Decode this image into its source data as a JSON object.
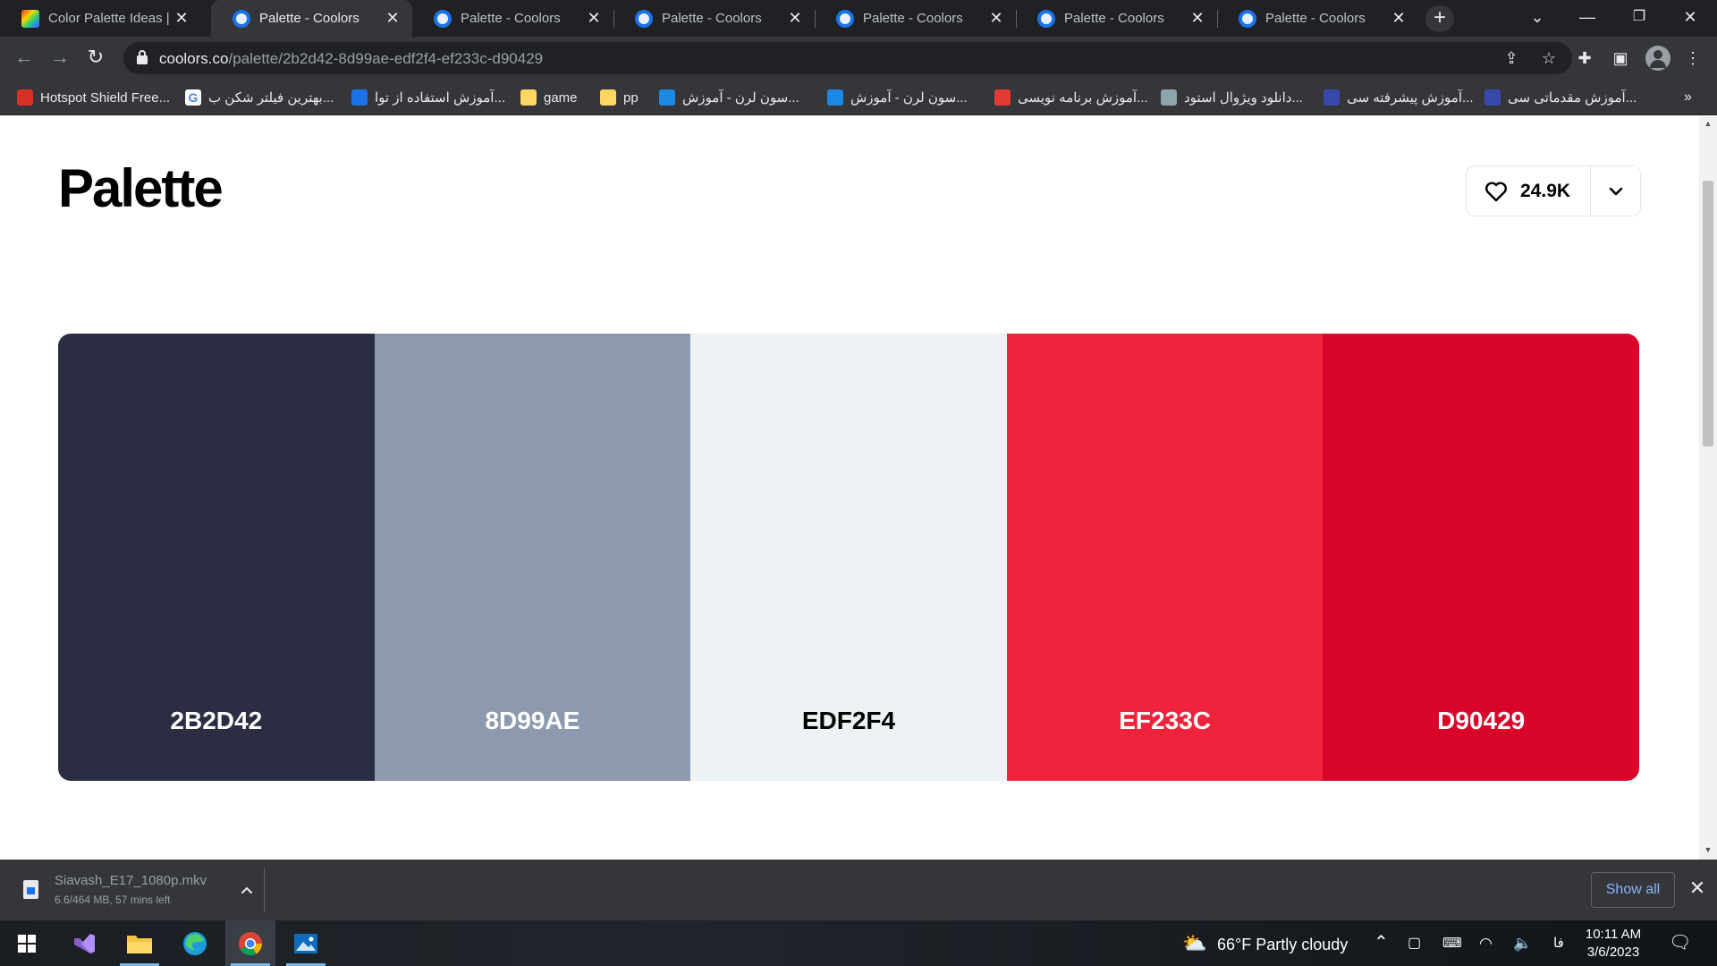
{
  "browser": {
    "tabs": [
      {
        "title": "Color Palette Ideas | C",
        "favicon": "colorpalettes-favicon",
        "active": false
      },
      {
        "title": "Palette - Coolors",
        "favicon": "coolors-favicon",
        "active": true
      },
      {
        "title": "Palette - Coolors",
        "favicon": "coolors-favicon",
        "active": false
      },
      {
        "title": "Palette - Coolors",
        "favicon": "coolors-favicon",
        "active": false
      },
      {
        "title": "Palette - Coolors",
        "favicon": "coolors-favicon",
        "active": false
      },
      {
        "title": "Palette - Coolors",
        "favicon": "coolors-favicon",
        "active": false
      },
      {
        "title": "Palette - Coolors",
        "favicon": "coolors-favicon",
        "active": false
      }
    ],
    "url_host": "coolors.co",
    "url_path": "/palette/2b2d42-8d99ae-edf2f4-ef233c-d90429",
    "bookmarks": [
      {
        "label": "Hotspot Shield Free...",
        "icon": "hotspot-icon"
      },
      {
        "label": "بهترین فیلتر شکن ب...",
        "icon": "google-icon"
      },
      {
        "label": "آموزش استفاده از توا...",
        "icon": "site-icon"
      },
      {
        "label": "game",
        "icon": "folder-icon"
      },
      {
        "label": "pp",
        "icon": "folder-icon"
      },
      {
        "label": "سون لرن - آموزش...",
        "icon": "sevenlearn-icon"
      },
      {
        "label": "سون لرن - آموزش...",
        "icon": "sevenlearn-icon"
      },
      {
        "label": "آموزش برنامه نویسی...",
        "icon": "site-icon"
      },
      {
        "label": "دانلود ویژوال استود...",
        "icon": "site-icon"
      },
      {
        "label": "آموزش پیشرفته سی...",
        "icon": "site-icon"
      },
      {
        "label": "آموزش مقدماتی سی...",
        "icon": "site-icon"
      }
    ]
  },
  "page": {
    "title": "Palette",
    "likes": "24.9K",
    "swatches": [
      {
        "hex": "2B2D42",
        "color": "#2B2D42",
        "text_color": "#ffffff"
      },
      {
        "hex": "8D99AE",
        "color": "#8D99AE",
        "text_color": "#ffffff"
      },
      {
        "hex": "EDF2F4",
        "color": "#EDF2F4",
        "text_color": "#000000"
      },
      {
        "hex": "EF233C",
        "color": "#EF233C",
        "text_color": "#ffffff"
      },
      {
        "hex": "D90429",
        "color": "#D90429",
        "text_color": "#ffffff"
      }
    ]
  },
  "download": {
    "filename": "Siavash_E17_1080p.mkv",
    "status": "6.6/464 MB, 57 mins left",
    "show_all": "Show all"
  },
  "taskbar": {
    "weather": "66°F  Partly cloudy",
    "language": "فا",
    "time": "10:11 AM",
    "date": "3/6/2023"
  }
}
